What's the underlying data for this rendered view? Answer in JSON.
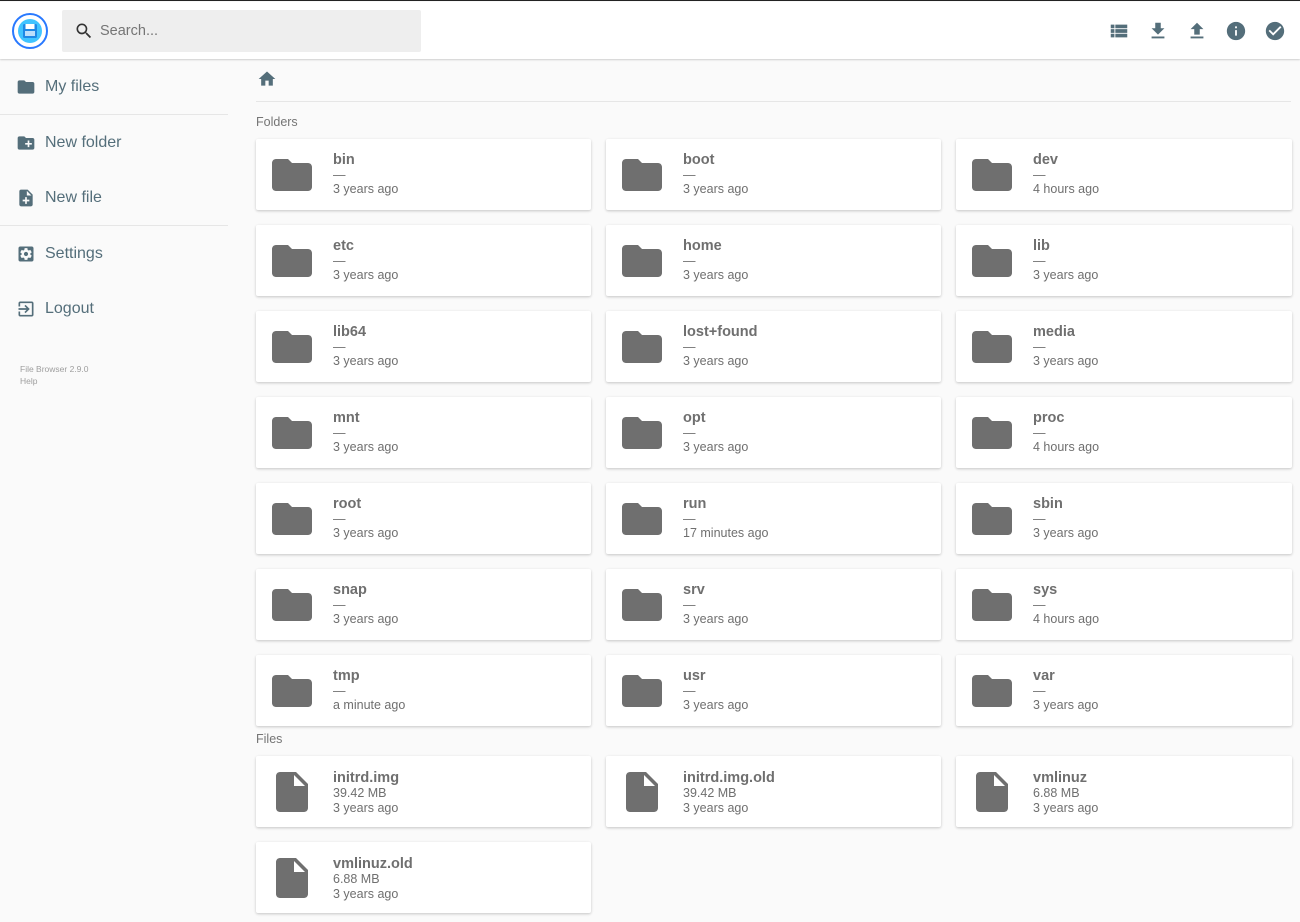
{
  "header": {
    "search_placeholder": "Search...",
    "actions": [
      "list-view-icon",
      "download-icon",
      "upload-icon",
      "info-icon",
      "select-check-icon"
    ]
  },
  "sidebar": {
    "items": [
      {
        "label": "My files",
        "icon": "folder-icon"
      },
      {
        "label": "New folder",
        "icon": "create-new-folder-icon"
      },
      {
        "label": "New file",
        "icon": "note-add-icon"
      },
      {
        "label": "Settings",
        "icon": "settings-icon"
      },
      {
        "label": "Logout",
        "icon": "exit-icon"
      }
    ],
    "credits": {
      "version": "File Browser 2.9.0",
      "help": "Help"
    }
  },
  "main": {
    "folders_title": "Folders",
    "files_title": "Files",
    "folders": [
      {
        "name": "bin",
        "size": "—",
        "modified": "3 years ago"
      },
      {
        "name": "boot",
        "size": "—",
        "modified": "3 years ago"
      },
      {
        "name": "dev",
        "size": "—",
        "modified": "4 hours ago"
      },
      {
        "name": "etc",
        "size": "—",
        "modified": "3 years ago"
      },
      {
        "name": "home",
        "size": "—",
        "modified": "3 years ago"
      },
      {
        "name": "lib",
        "size": "—",
        "modified": "3 years ago"
      },
      {
        "name": "lib64",
        "size": "—",
        "modified": "3 years ago"
      },
      {
        "name": "lost+found",
        "size": "—",
        "modified": "3 years ago"
      },
      {
        "name": "media",
        "size": "—",
        "modified": "3 years ago"
      },
      {
        "name": "mnt",
        "size": "—",
        "modified": "3 years ago"
      },
      {
        "name": "opt",
        "size": "—",
        "modified": "3 years ago"
      },
      {
        "name": "proc",
        "size": "—",
        "modified": "4 hours ago"
      },
      {
        "name": "root",
        "size": "—",
        "modified": "3 years ago"
      },
      {
        "name": "run",
        "size": "—",
        "modified": "17 minutes ago"
      },
      {
        "name": "sbin",
        "size": "—",
        "modified": "3 years ago"
      },
      {
        "name": "snap",
        "size": "—",
        "modified": "3 years ago"
      },
      {
        "name": "srv",
        "size": "—",
        "modified": "3 years ago"
      },
      {
        "name": "sys",
        "size": "—",
        "modified": "4 hours ago"
      },
      {
        "name": "tmp",
        "size": "—",
        "modified": "a minute ago"
      },
      {
        "name": "usr",
        "size": "—",
        "modified": "3 years ago"
      },
      {
        "name": "var",
        "size": "—",
        "modified": "3 years ago"
      }
    ],
    "files": [
      {
        "name": "initrd.img",
        "size": "39.42 MB",
        "modified": "3 years ago"
      },
      {
        "name": "initrd.img.old",
        "size": "39.42 MB",
        "modified": "3 years ago"
      },
      {
        "name": "vmlinuz",
        "size": "6.88 MB",
        "modified": "3 years ago"
      },
      {
        "name": "vmlinuz.old",
        "size": "6.88 MB",
        "modified": "3 years ago"
      }
    ]
  }
}
